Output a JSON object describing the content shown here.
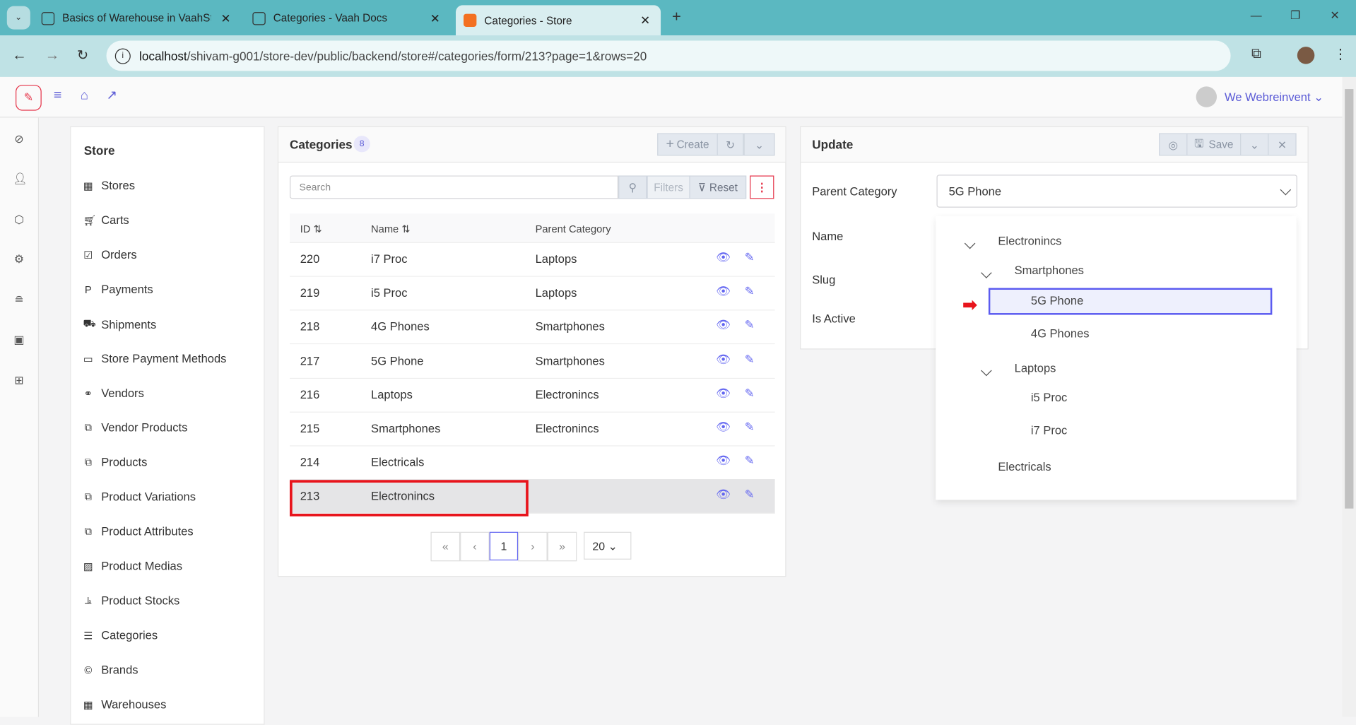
{
  "browser": {
    "tabs": [
      {
        "title": "Basics of Warehouse in VaahSto"
      },
      {
        "title": "Categories - Vaah Docs"
      },
      {
        "title": "Categories - Store"
      }
    ],
    "url_host": "localhost",
    "url_path": "/shivam-g001/store-dev/public/backend/store#/categories/form/213?page=1&rows=20"
  },
  "topnav": {
    "user": "We Webreinvent"
  },
  "sidebar": {
    "title": "Store",
    "items": [
      {
        "label": "Stores",
        "icon": "building-icon"
      },
      {
        "label": "Carts",
        "icon": "cart-icon"
      },
      {
        "label": "Orders",
        "icon": "check-square-icon"
      },
      {
        "label": "Payments",
        "icon": "paypal-icon"
      },
      {
        "label": "Shipments",
        "icon": "truck-icon"
      },
      {
        "label": "Store Payment Methods",
        "icon": "credit-card-icon"
      },
      {
        "label": "Vendors",
        "icon": "handshake-icon"
      },
      {
        "label": "Vendor Products",
        "icon": "clone-icon"
      },
      {
        "label": "Products",
        "icon": "clone-icon"
      },
      {
        "label": "Product Variations",
        "icon": "clone-icon"
      },
      {
        "label": "Product Attributes",
        "icon": "clone-icon"
      },
      {
        "label": "Product Medias",
        "icon": "image-icon"
      },
      {
        "label": "Product Stocks",
        "icon": "chart-bar-icon"
      },
      {
        "label": "Categories",
        "icon": "list-icon"
      },
      {
        "label": "Brands",
        "icon": "copyright-icon"
      },
      {
        "label": "Warehouses",
        "icon": "building-icon"
      }
    ]
  },
  "list": {
    "title": "Categories",
    "count": "8",
    "create": "Create",
    "search_placeholder": "Search",
    "filters": "Filters",
    "reset": "Reset",
    "columns": [
      "ID",
      "Name",
      "Parent Category"
    ],
    "rows": [
      {
        "id": "220",
        "name": "i7 Proc",
        "parent": "Laptops"
      },
      {
        "id": "219",
        "name": "i5 Proc",
        "parent": "Laptops"
      },
      {
        "id": "218",
        "name": "4G Phones",
        "parent": "Smartphones"
      },
      {
        "id": "217",
        "name": "5G Phone",
        "parent": "Smartphones"
      },
      {
        "id": "216",
        "name": "Laptops",
        "parent": "Electronincs"
      },
      {
        "id": "215",
        "name": "Smartphones",
        "parent": "Electronincs"
      },
      {
        "id": "214",
        "name": "Electricals",
        "parent": ""
      },
      {
        "id": "213",
        "name": "Electronincs",
        "parent": ""
      }
    ],
    "page": "1",
    "rows_per_page": "20"
  },
  "form": {
    "title": "Update",
    "save": "Save",
    "labels": {
      "parent": "Parent Category",
      "name": "Name",
      "slug": "Slug",
      "active": "Is Active"
    },
    "parent_value": "5G Phone",
    "tree": [
      {
        "label": "Electronincs",
        "level": 0,
        "expanded": true
      },
      {
        "label": "Smartphones",
        "level": 1,
        "expanded": true
      },
      {
        "label": "5G Phone",
        "level": 2,
        "selected": true
      },
      {
        "label": "4G Phones",
        "level": 2
      },
      {
        "label": "Laptops",
        "level": 1,
        "expanded": true
      },
      {
        "label": "i5 Proc",
        "level": 2
      },
      {
        "label": "i7 Proc",
        "level": 2
      },
      {
        "label": "Electricals",
        "level": 0
      }
    ]
  },
  "colors": {
    "accent": "#6366f1",
    "tab_bar": "#5bb8c1",
    "highlight": "#e8141c"
  }
}
